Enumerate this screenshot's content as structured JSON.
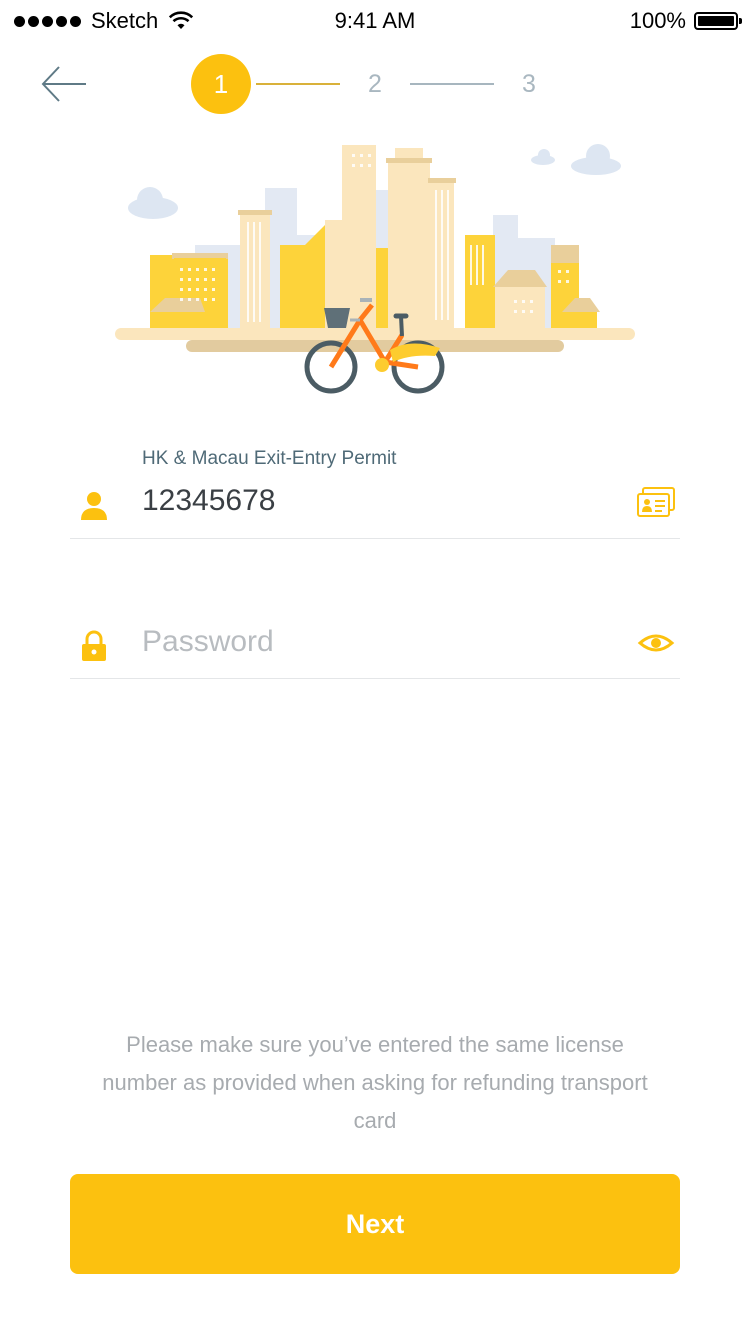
{
  "status_bar": {
    "carrier": "Sketch",
    "time": "9:41 AM",
    "battery": "100%",
    "signal_icon": "signal-dots-icon",
    "wifi_icon": "wifi-icon"
  },
  "stepper": {
    "back_icon": "arrow-left-icon",
    "steps": [
      {
        "label": "1",
        "state": "active"
      },
      {
        "label": "2",
        "state": "inactive"
      },
      {
        "label": "3",
        "state": "inactive"
      }
    ]
  },
  "illustration": {
    "description_icon": "city-bicycle-illustration"
  },
  "permit_field": {
    "label": "HK & Macau Exit-Entry Permit",
    "value": "12345678",
    "leading_icon": "user-icon",
    "trailing_icon": "id-card-icon"
  },
  "password_field": {
    "placeholder": "Password",
    "value": "",
    "leading_icon": "lock-icon",
    "trailing_icon": "eye-icon"
  },
  "note": "Please make sure you’ve entered the same license number as provided when asking for refunding transport card",
  "next_button": {
    "label": "Next"
  },
  "colors": {
    "accent": "#fcc10f",
    "muted_step": "#a9b7c0",
    "label_text": "#4f6a77",
    "hint_text": "#a7abaf"
  }
}
